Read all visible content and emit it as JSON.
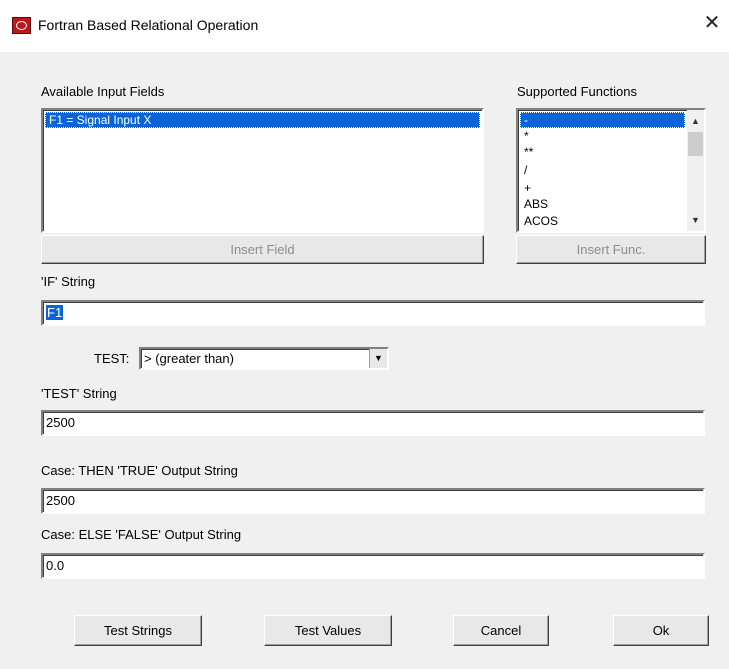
{
  "window": {
    "title": "Fortran Based Relational Operation",
    "close_icon": "close-x-icon"
  },
  "fields_panel": {
    "label": "Available Input Fields",
    "items": [
      "F1 = Signal Input X"
    ],
    "selected_index": 0,
    "insert_button": "Insert Field"
  },
  "functions_panel": {
    "label": "Supported Functions",
    "items": [
      "-",
      "*",
      "**",
      "/",
      "+",
      "ABS",
      "ACOS"
    ],
    "selected_index": 0,
    "insert_button": "Insert Func."
  },
  "if_string": {
    "label": "'IF' String",
    "value": "F1"
  },
  "test": {
    "label": "TEST:",
    "selected": "> (greater than)"
  },
  "test_string": {
    "label": "'TEST' String",
    "value": "2500"
  },
  "true_output": {
    "label": "Case:  THEN 'TRUE' Output String",
    "value": "2500"
  },
  "false_output": {
    "label": "Case: ELSE 'FALSE' Output String",
    "value": "0.0"
  },
  "buttons": {
    "test_strings": "Test Strings",
    "test_values": "Test Values",
    "cancel": "Cancel",
    "ok": "Ok"
  }
}
